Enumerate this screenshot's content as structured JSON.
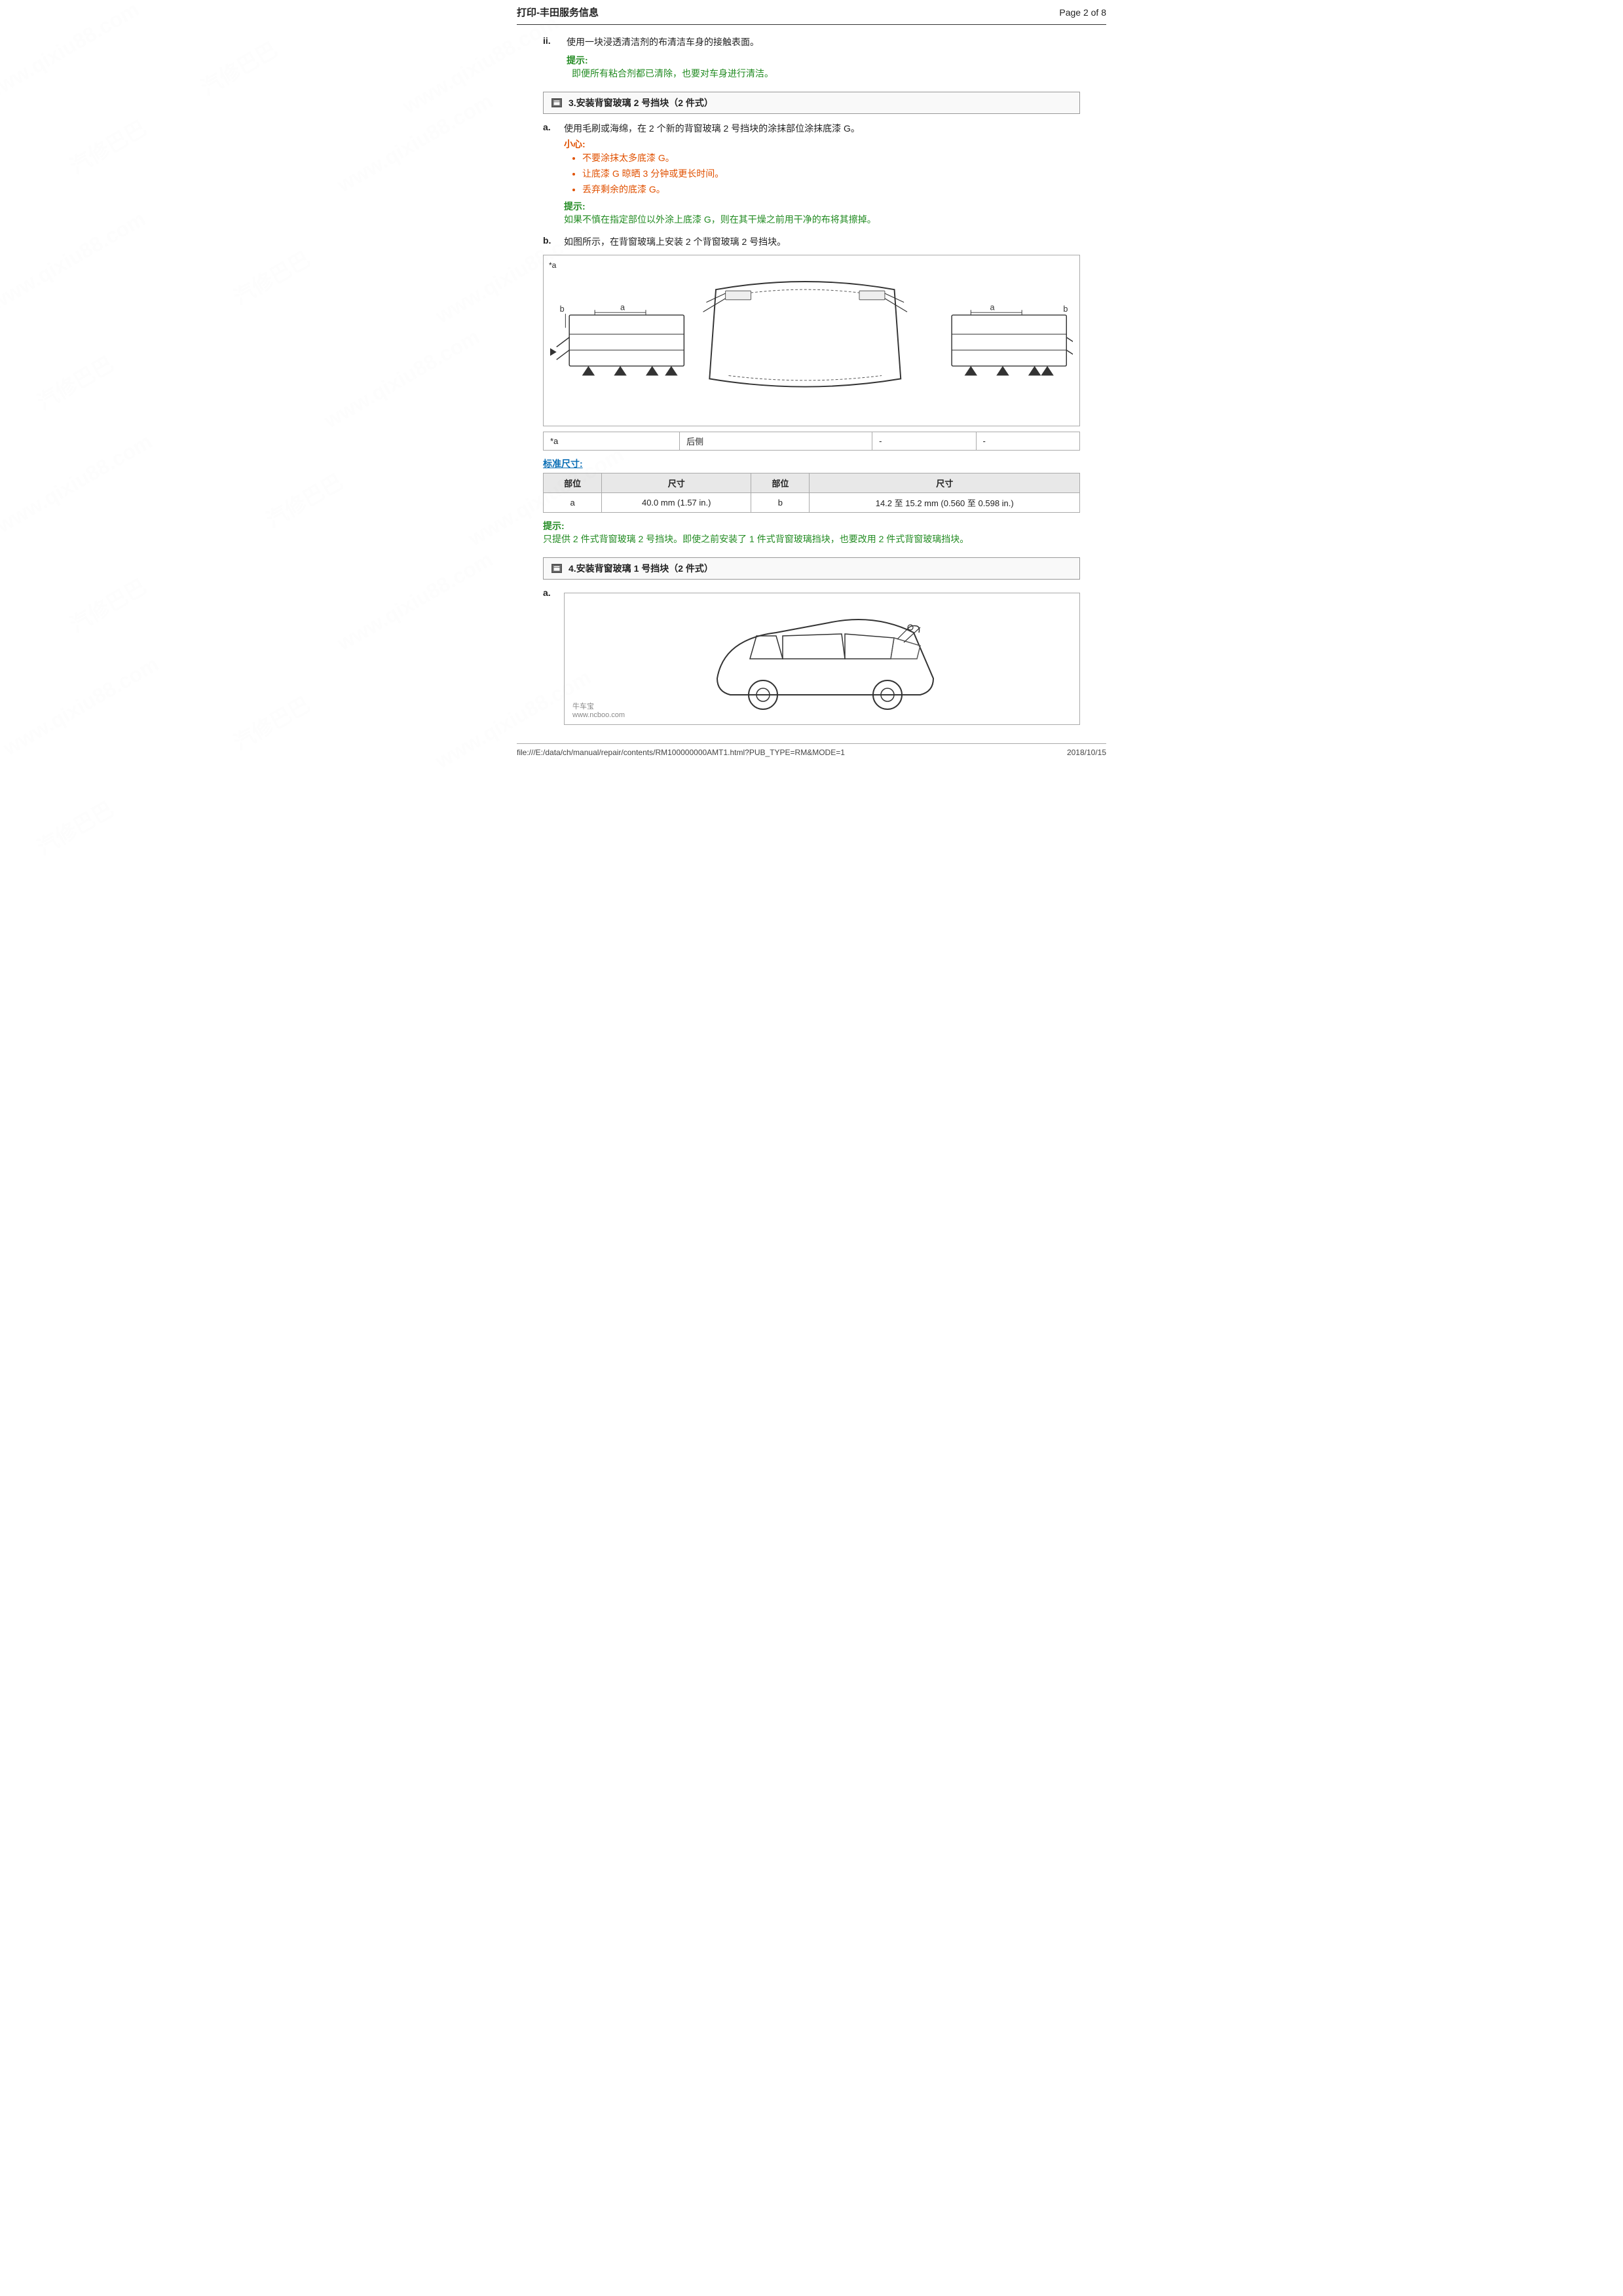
{
  "header": {
    "title": "打印-丰田服务信息",
    "page_info": "Page 2 of 8"
  },
  "watermark_texts": [
    "www.qixiu88.com",
    "汽修巴巴",
    "www.qixiu88.com",
    "汽修巴巴"
  ],
  "step_ii": {
    "label": "ii.",
    "text": "使用一块浸透清洁剂的布清洁车身的接触表面。"
  },
  "hint1": {
    "label": "提示:",
    "text": "即便所有粘合剂都已清除，也要对车身进行清洁。"
  },
  "section3": {
    "icon": "▣",
    "title": "3.安装背窗玻璃 2 号挡块（2 件式）"
  },
  "substep_a_text": "使用毛刷或海绵，在 2 个新的背窗玻璃 2 号挡块的涂抹部位涂抹底漆 G。",
  "caution": {
    "label": "小心:",
    "items": [
      "不要涂抹太多底漆 G。",
      "让底漆 G 晾晒 3 分钟或更长时间。",
      "丢弃剩余的底漆 G。"
    ]
  },
  "hint2": {
    "label": "提示:",
    "text": "如果不慎在指定部位以外涂上底漆 G，则在其干燥之前用干净的布将其擦掉。"
  },
  "substep_b_text": "如图所示，在背窗玻璃上安装 2 个背窗玻璃 2 号挡块。",
  "diagram_star_label": "*a",
  "diagram_table": {
    "row": {
      "col1": "*a",
      "col2": "后侧",
      "col3": "-",
      "col4": "-"
    }
  },
  "std_dimensions": {
    "label": "标准尺寸:",
    "headers": [
      "部位",
      "尺寸",
      "部位",
      "尺寸"
    ],
    "rows": [
      [
        "a",
        "40.0 mm (1.57 in.)",
        "b",
        "14.2 至 15.2 mm (0.560 至 0.598 in.)"
      ]
    ]
  },
  "hint3": {
    "label": "提示:",
    "text": "只提供 2 件式背窗玻璃 2 号挡块。即使之前安装了 1 件式背窗玻璃挡块，也要改用 2 件式背窗玻璃挡块。"
  },
  "section4": {
    "icon": "▣",
    "title": "4.安装背窗玻璃 1 号挡块（2 件式）"
  },
  "substep_a2_label": "a.",
  "footer": {
    "file_path": "file:///E:/data/ch/manual/repair/contents/RM100000000AMT1.html?PUB_TYPE=RM&MODE=1",
    "date": "2018/10/15"
  },
  "labels": {
    "a": "a",
    "b": "b",
    "star_a": "*a",
    "rear_side": "后侧",
    "dash": "-"
  },
  "watermark1": "www.qixiu88.com",
  "watermark2": "汽修巴巴",
  "shop_label": "牛车宝",
  "shop_url": "www.ncboo.com"
}
